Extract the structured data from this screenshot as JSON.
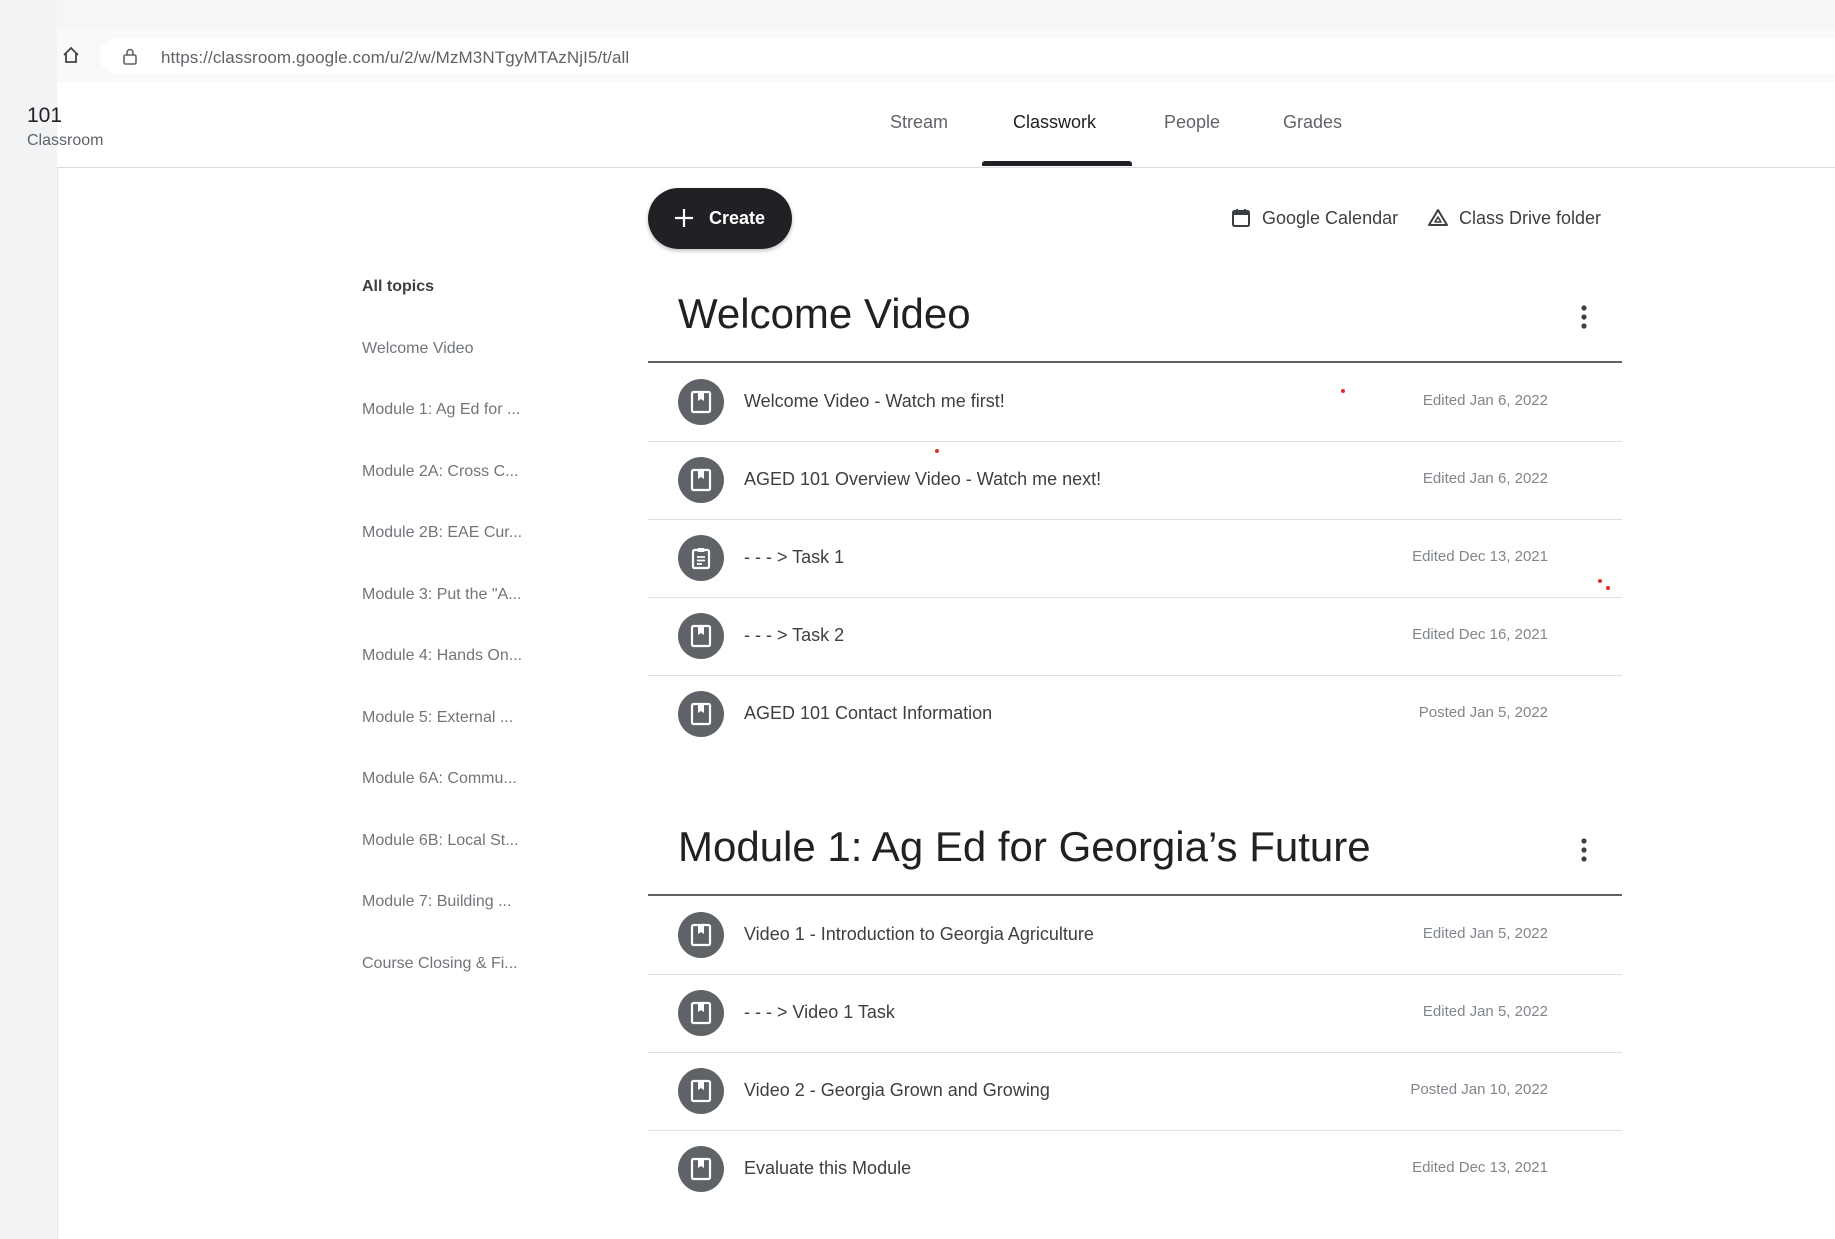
{
  "browser": {
    "url": "https://classroom.google.com/u/2/w/MzM3NTgyMTAzNjI5/t/all",
    "home_icon": "home-icon",
    "lock_icon": "lock-icon"
  },
  "class": {
    "title": "101",
    "subtitle": "Classroom"
  },
  "tabs": [
    {
      "label": "Stream"
    },
    {
      "label": "Classwork",
      "active": true
    },
    {
      "label": "People"
    },
    {
      "label": "Grades"
    }
  ],
  "toolbar": {
    "create_label": "Create",
    "calendar_label": "Google Calendar",
    "drive_label": "Class Drive folder"
  },
  "topics": [
    "All topics",
    "Welcome Video",
    "Module 1: Ag Ed for ...",
    "Module 2A: Cross C...",
    "Module 2B: EAE Cur...",
    "Module 3: Put the \"A...",
    "Module 4: Hands On...",
    "Module 5: External ...",
    "Module 6A: Commu...",
    "Module 6B: Local St...",
    "Module 7: Building ...",
    "Course Closing & Fi..."
  ],
  "sections": [
    {
      "title": "Welcome Video",
      "items": [
        {
          "title": "Welcome Video - Watch me first!",
          "date": "Edited Jan 6, 2022",
          "icon": "material-icon"
        },
        {
          "title": "AGED 101 Overview Video - Watch me next!",
          "date": "Edited Jan 6, 2022",
          "icon": "material-icon"
        },
        {
          "title": "- - - > Task 1",
          "date": "Edited Dec 13, 2021",
          "icon": "assignment-icon"
        },
        {
          "title": "- - - > Task 2",
          "date": "Edited Dec 16, 2021",
          "icon": "material-icon"
        },
        {
          "title": "AGED 101 Contact Information",
          "date": "Posted Jan 5, 2022",
          "icon": "material-icon"
        }
      ]
    },
    {
      "title": "Module 1: Ag Ed for Georgia’s Future",
      "items": [
        {
          "title": "Video 1 - Introduction to Georgia Agriculture",
          "date": "Edited Jan 5, 2022",
          "icon": "material-icon"
        },
        {
          "title": "- - - > Video 1 Task",
          "date": "Edited Jan 5, 2022",
          "icon": "material-icon"
        },
        {
          "title": "Video 2 - Georgia Grown and Growing",
          "date": "Posted Jan 10, 2022",
          "icon": "material-icon"
        },
        {
          "title": "Evaluate this Module",
          "date": "Edited Dec 13, 2021",
          "icon": "material-icon"
        }
      ]
    }
  ]
}
